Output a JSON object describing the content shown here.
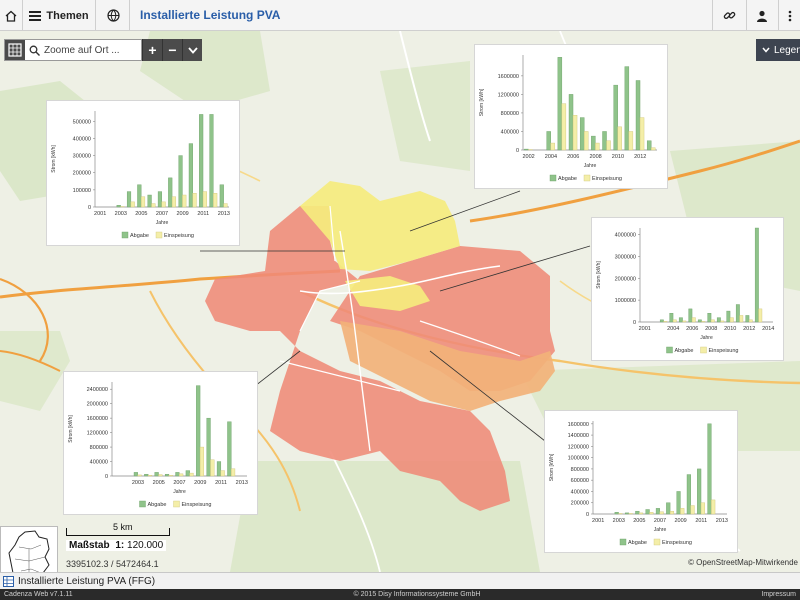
{
  "topbar": {
    "themes_label": "Themen",
    "title": "Installierte Leistung PVA"
  },
  "map_controls": {
    "search_placeholder": "Zoome auf Ort ...",
    "zoom_in": "+",
    "zoom_out": "−",
    "expand": "⌄",
    "legend_label": "Legende"
  },
  "scale": {
    "scale_bar_label": "5 km",
    "label": "Maßstab",
    "prefix": "1:",
    "value": "120.000",
    "coords": "3395102.3 / 5472464.1"
  },
  "copyright": "© OpenStreetMap-Mitwirkende",
  "bottombar": {
    "layer_label": "Installierte Leistung PVA (FFG)"
  },
  "statusbar": {
    "left": "Cadenza Web v7.1.11",
    "center": "© 2015 Disy Informationssysteme GmbH",
    "right": "Impressum"
  },
  "chart_legend": {
    "series_a": "Abgabe",
    "series_b": "Einspeisung"
  },
  "chart_axis": {
    "x_label": "Jahre",
    "y_label": "Strom [kWh]"
  },
  "colors": {
    "series_a": "#8fc38a",
    "series_b": "#f4eea8",
    "region_red": "#ef8a78",
    "region_orange": "#f2b27a",
    "region_yellow": "#f5ec7e",
    "accent": "#2a5ea8"
  },
  "chart_data": [
    {
      "id": "chart-1",
      "type": "bar",
      "title": "",
      "xlabel": "Jahre",
      "ylabel": "Strom [kWh]",
      "categories": [
        "2001",
        "2002",
        "2003",
        "2004",
        "2005",
        "2006",
        "2007",
        "2008",
        "2009",
        "2010",
        "2011",
        "2012",
        "2013"
      ],
      "xtick_labels": [
        "2001",
        "2003",
        "2005",
        "2007",
        "2009",
        "2011",
        "2013"
      ],
      "yticks": [
        0,
        100000,
        200000,
        300000,
        400000,
        500000
      ],
      "ytick_labels": [
        "0",
        "100000",
        "200000",
        "300000",
        "400000",
        "500000"
      ],
      "ylim": [
        0,
        560000
      ],
      "series": [
        {
          "name": "Abgabe",
          "values": [
            0,
            0,
            10000,
            90000,
            130000,
            70000,
            90000,
            170000,
            300000,
            370000,
            540000,
            540000,
            130000
          ]
        },
        {
          "name": "Einspeisung",
          "values": [
            0,
            0,
            3000,
            30000,
            60000,
            20000,
            30000,
            60000,
            70000,
            80000,
            90000,
            80000,
            20000
          ]
        }
      ]
    },
    {
      "id": "chart-2",
      "type": "bar",
      "title": "",
      "xlabel": "Jahre",
      "ylabel": "Strom [kWh]",
      "categories": [
        "2002",
        "2003",
        "2004",
        "2005",
        "2006",
        "2007",
        "2008",
        "2009",
        "2010",
        "2011",
        "2012",
        "2013"
      ],
      "xtick_labels": [
        "2002",
        "2004",
        "2006",
        "2008",
        "2010",
        "2012"
      ],
      "yticks": [
        0,
        400000,
        800000,
        1200000,
        1600000
      ],
      "ytick_labels": [
        "0",
        "400000",
        "800000",
        "1200000",
        "1600000"
      ],
      "ylim": [
        0,
        2050000
      ],
      "series": [
        {
          "name": "Abgabe",
          "values": [
            20000,
            0,
            400000,
            2000000,
            1200000,
            700000,
            300000,
            400000,
            1400000,
            1800000,
            1500000,
            200000
          ]
        },
        {
          "name": "Einspeisung",
          "values": [
            10000,
            0,
            150000,
            1000000,
            750000,
            400000,
            150000,
            200000,
            500000,
            400000,
            700000,
            50000
          ]
        }
      ]
    },
    {
      "id": "chart-3",
      "type": "bar",
      "title": "",
      "xlabel": "Jahre",
      "ylabel": "Strom [kWh]",
      "categories": [
        "2001",
        "2002",
        "2003",
        "2004",
        "2005",
        "2006",
        "2007",
        "2008",
        "2009",
        "2010",
        "2011",
        "2012",
        "2013",
        "2014"
      ],
      "xtick_labels": [
        "2001",
        "2004",
        "2006",
        "2008",
        "2010",
        "2012",
        "2014"
      ],
      "yticks": [
        0,
        1000000,
        2000000,
        3000000,
        4000000
      ],
      "ytick_labels": [
        "0",
        "1000000",
        "2000000",
        "3000000",
        "4000000"
      ],
      "ylim": [
        0,
        4300000
      ],
      "series": [
        {
          "name": "Abgabe",
          "values": [
            0,
            0,
            100000,
            400000,
            200000,
            600000,
            100000,
            400000,
            200000,
            500000,
            800000,
            300000,
            4300000,
            0
          ]
        },
        {
          "name": "Einspeisung",
          "values": [
            0,
            0,
            30000,
            100000,
            50000,
            200000,
            30000,
            100000,
            50000,
            200000,
            300000,
            100000,
            600000,
            0
          ]
        }
      ]
    },
    {
      "id": "chart-4",
      "type": "bar",
      "title": "",
      "xlabel": "Jahre",
      "ylabel": "Strom [kWh]",
      "categories": [
        "2001",
        "2002",
        "2003",
        "2004",
        "2005",
        "2006",
        "2007",
        "2008",
        "2009",
        "2010",
        "2011",
        "2012",
        "2013"
      ],
      "xtick_labels": [
        "2003",
        "2005",
        "2007",
        "2009",
        "2011",
        "2013"
      ],
      "yticks": [
        0,
        400000,
        800000,
        1200000,
        1600000,
        2000000,
        2400000
      ],
      "ytick_labels": [
        "0",
        "400000",
        "800000",
        "1200000",
        "1600000",
        "2000000",
        "2400000"
      ],
      "ylim": [
        0,
        2600000
      ],
      "series": [
        {
          "name": "Abgabe",
          "values": [
            0,
            0,
            100000,
            50000,
            100000,
            50000,
            100000,
            150000,
            2500000,
            1600000,
            400000,
            1500000,
            0
          ]
        },
        {
          "name": "Einspeisung",
          "values": [
            0,
            0,
            30000,
            20000,
            40000,
            20000,
            60000,
            80000,
            800000,
            450000,
            150000,
            200000,
            0
          ]
        }
      ]
    },
    {
      "id": "chart-5",
      "type": "bar",
      "title": "",
      "xlabel": "Jahre",
      "ylabel": "Strom [kWh]",
      "categories": [
        "2001",
        "2002",
        "2003",
        "2004",
        "2005",
        "2006",
        "2007",
        "2008",
        "2009",
        "2010",
        "2011",
        "2012",
        "2013"
      ],
      "xtick_labels": [
        "2001",
        "2003",
        "2005",
        "2007",
        "2009",
        "2011",
        "2013"
      ],
      "yticks": [
        0,
        200000,
        400000,
        600000,
        800000,
        1000000,
        1200000,
        1400000,
        1600000
      ],
      "ytick_labels": [
        "0",
        "200000",
        "400000",
        "600000",
        "800000",
        "1000000",
        "1200000",
        "1400000",
        "1600000"
      ],
      "ylim": [
        0,
        1650000
      ],
      "series": [
        {
          "name": "Abgabe",
          "values": [
            0,
            0,
            30000,
            20000,
            50000,
            80000,
            100000,
            200000,
            400000,
            700000,
            800000,
            1600000,
            0
          ]
        },
        {
          "name": "Einspeisung",
          "values": [
            0,
            0,
            10000,
            10000,
            20000,
            30000,
            40000,
            50000,
            100000,
            150000,
            200000,
            250000,
            0
          ]
        }
      ]
    }
  ]
}
